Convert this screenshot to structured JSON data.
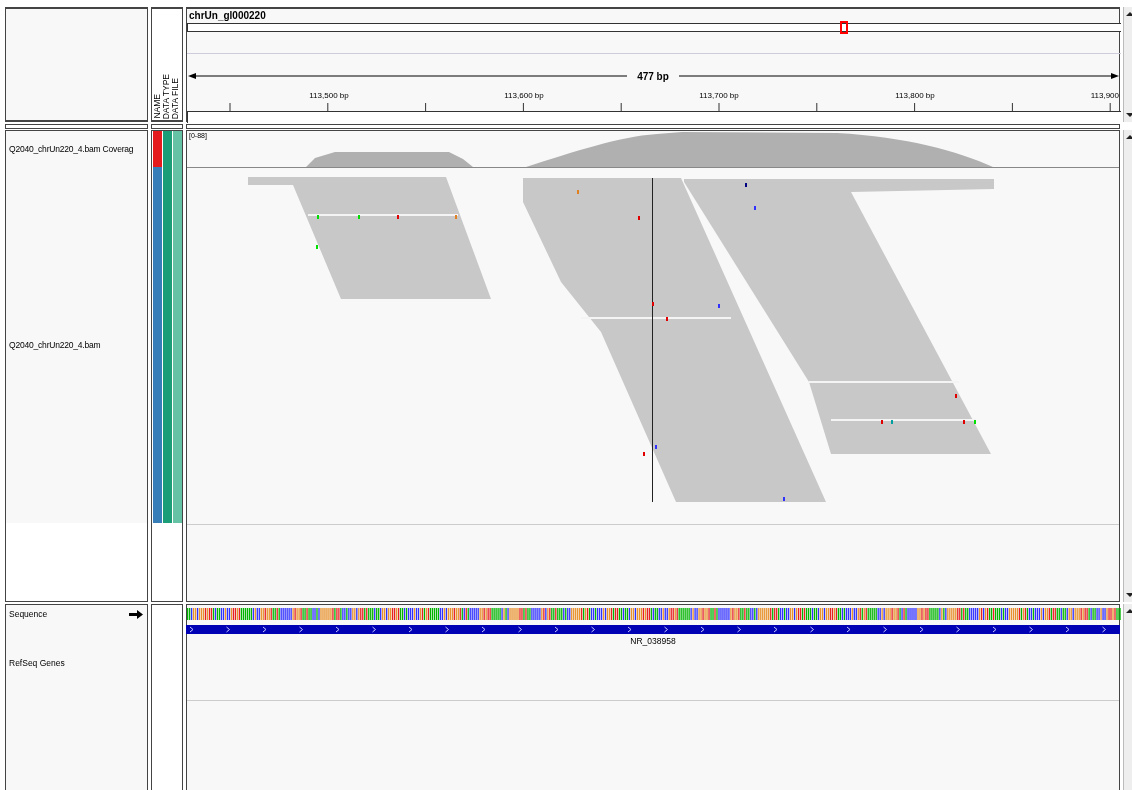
{
  "ruler": {
    "chromosome": "chrUn_gl000220",
    "span": "477 bp",
    "ticks": [
      "113,500 bp",
      "113,600 bp",
      "113,700 bp",
      "113,800 bp",
      "113,900"
    ]
  },
  "attribute_headers": [
    "NAME",
    "DATA TYPE",
    "DATA FILE"
  ],
  "data_panel": {
    "tracks": [
      {
        "name": "Q2040_chrUn220_4.bam Coverag",
        "kind": "coverage",
        "range": "[0-88]",
        "attributes": [
          {
            "color": "#e41a1c"
          },
          {
            "color": "#1b9e77"
          },
          {
            "color": "#66c2a5"
          }
        ]
      },
      {
        "name": "Q2040_chrUn220_4.bam",
        "kind": "alignments",
        "attributes": [
          {
            "color": "#377eb8"
          },
          {
            "color": "#1b9e77"
          },
          {
            "color": "#66c2a5"
          }
        ]
      }
    ]
  },
  "feature_panel": {
    "tracks": [
      {
        "name": "Sequence",
        "kind": "sequence"
      },
      {
        "name": "RefSeq Genes",
        "kind": "gene",
        "feature_label": "NR_038958"
      }
    ]
  }
}
